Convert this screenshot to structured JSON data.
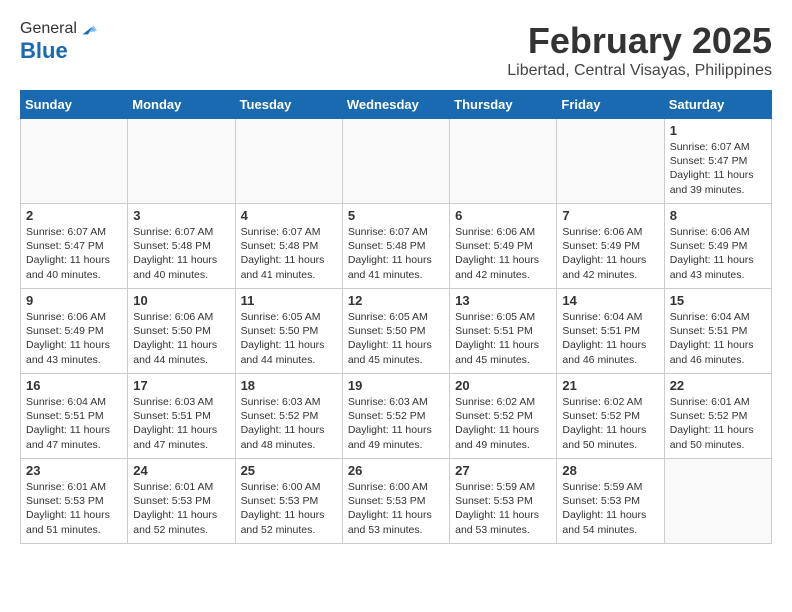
{
  "header": {
    "logo_line1": "General",
    "logo_line2": "Blue",
    "month": "February 2025",
    "location": "Libertad, Central Visayas, Philippines"
  },
  "weekdays": [
    "Sunday",
    "Monday",
    "Tuesday",
    "Wednesday",
    "Thursday",
    "Friday",
    "Saturday"
  ],
  "weeks": [
    [
      {
        "day": "",
        "info": ""
      },
      {
        "day": "",
        "info": ""
      },
      {
        "day": "",
        "info": ""
      },
      {
        "day": "",
        "info": ""
      },
      {
        "day": "",
        "info": ""
      },
      {
        "day": "",
        "info": ""
      },
      {
        "day": "1",
        "info": "Sunrise: 6:07 AM\nSunset: 5:47 PM\nDaylight: 11 hours\nand 39 minutes."
      }
    ],
    [
      {
        "day": "2",
        "info": "Sunrise: 6:07 AM\nSunset: 5:47 PM\nDaylight: 11 hours\nand 40 minutes."
      },
      {
        "day": "3",
        "info": "Sunrise: 6:07 AM\nSunset: 5:48 PM\nDaylight: 11 hours\nand 40 minutes."
      },
      {
        "day": "4",
        "info": "Sunrise: 6:07 AM\nSunset: 5:48 PM\nDaylight: 11 hours\nand 41 minutes."
      },
      {
        "day": "5",
        "info": "Sunrise: 6:07 AM\nSunset: 5:48 PM\nDaylight: 11 hours\nand 41 minutes."
      },
      {
        "day": "6",
        "info": "Sunrise: 6:06 AM\nSunset: 5:49 PM\nDaylight: 11 hours\nand 42 minutes."
      },
      {
        "day": "7",
        "info": "Sunrise: 6:06 AM\nSunset: 5:49 PM\nDaylight: 11 hours\nand 42 minutes."
      },
      {
        "day": "8",
        "info": "Sunrise: 6:06 AM\nSunset: 5:49 PM\nDaylight: 11 hours\nand 43 minutes."
      }
    ],
    [
      {
        "day": "9",
        "info": "Sunrise: 6:06 AM\nSunset: 5:49 PM\nDaylight: 11 hours\nand 43 minutes."
      },
      {
        "day": "10",
        "info": "Sunrise: 6:06 AM\nSunset: 5:50 PM\nDaylight: 11 hours\nand 44 minutes."
      },
      {
        "day": "11",
        "info": "Sunrise: 6:05 AM\nSunset: 5:50 PM\nDaylight: 11 hours\nand 44 minutes."
      },
      {
        "day": "12",
        "info": "Sunrise: 6:05 AM\nSunset: 5:50 PM\nDaylight: 11 hours\nand 45 minutes."
      },
      {
        "day": "13",
        "info": "Sunrise: 6:05 AM\nSunset: 5:51 PM\nDaylight: 11 hours\nand 45 minutes."
      },
      {
        "day": "14",
        "info": "Sunrise: 6:04 AM\nSunset: 5:51 PM\nDaylight: 11 hours\nand 46 minutes."
      },
      {
        "day": "15",
        "info": "Sunrise: 6:04 AM\nSunset: 5:51 PM\nDaylight: 11 hours\nand 46 minutes."
      }
    ],
    [
      {
        "day": "16",
        "info": "Sunrise: 6:04 AM\nSunset: 5:51 PM\nDaylight: 11 hours\nand 47 minutes."
      },
      {
        "day": "17",
        "info": "Sunrise: 6:03 AM\nSunset: 5:51 PM\nDaylight: 11 hours\nand 47 minutes."
      },
      {
        "day": "18",
        "info": "Sunrise: 6:03 AM\nSunset: 5:52 PM\nDaylight: 11 hours\nand 48 minutes."
      },
      {
        "day": "19",
        "info": "Sunrise: 6:03 AM\nSunset: 5:52 PM\nDaylight: 11 hours\nand 49 minutes."
      },
      {
        "day": "20",
        "info": "Sunrise: 6:02 AM\nSunset: 5:52 PM\nDaylight: 11 hours\nand 49 minutes."
      },
      {
        "day": "21",
        "info": "Sunrise: 6:02 AM\nSunset: 5:52 PM\nDaylight: 11 hours\nand 50 minutes."
      },
      {
        "day": "22",
        "info": "Sunrise: 6:01 AM\nSunset: 5:52 PM\nDaylight: 11 hours\nand 50 minutes."
      }
    ],
    [
      {
        "day": "23",
        "info": "Sunrise: 6:01 AM\nSunset: 5:53 PM\nDaylight: 11 hours\nand 51 minutes."
      },
      {
        "day": "24",
        "info": "Sunrise: 6:01 AM\nSunset: 5:53 PM\nDaylight: 11 hours\nand 52 minutes."
      },
      {
        "day": "25",
        "info": "Sunrise: 6:00 AM\nSunset: 5:53 PM\nDaylight: 11 hours\nand 52 minutes."
      },
      {
        "day": "26",
        "info": "Sunrise: 6:00 AM\nSunset: 5:53 PM\nDaylight: 11 hours\nand 53 minutes."
      },
      {
        "day": "27",
        "info": "Sunrise: 5:59 AM\nSunset: 5:53 PM\nDaylight: 11 hours\nand 53 minutes."
      },
      {
        "day": "28",
        "info": "Sunrise: 5:59 AM\nSunset: 5:53 PM\nDaylight: 11 hours\nand 54 minutes."
      },
      {
        "day": "",
        "info": ""
      }
    ]
  ]
}
